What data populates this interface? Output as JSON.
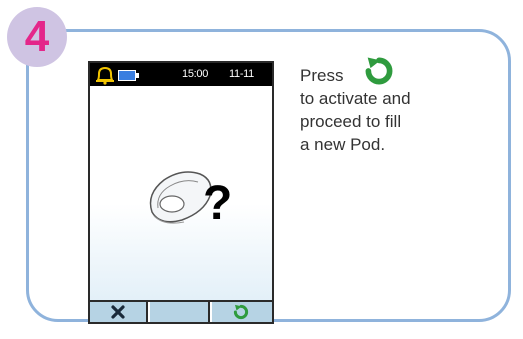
{
  "step": {
    "number": "4"
  },
  "device": {
    "status": {
      "time": "15:00",
      "date": "11-11",
      "bell_icon": "bell-icon",
      "battery_icon": "battery-icon"
    },
    "screen": {
      "pod_icon": "pod-icon",
      "question_mark": "?"
    },
    "softkeys": {
      "left_icon": "close-x-icon",
      "right_icon": "refresh-icon"
    }
  },
  "instructions": {
    "line1": "Press",
    "line2": "to activate and",
    "line3": "proceed to fill",
    "line4": "a new Pod.",
    "inline_icon": "refresh-icon"
  },
  "colors": {
    "badge_bg": "#cfc4e3",
    "badge_text": "#e4268a",
    "card_border": "#8fb3dc",
    "softkey_bg": "#b6d3e4",
    "accent_green": "#2f9b3e",
    "bell_yellow": "#f2c400",
    "battery_blue": "#3a7ee0"
  }
}
